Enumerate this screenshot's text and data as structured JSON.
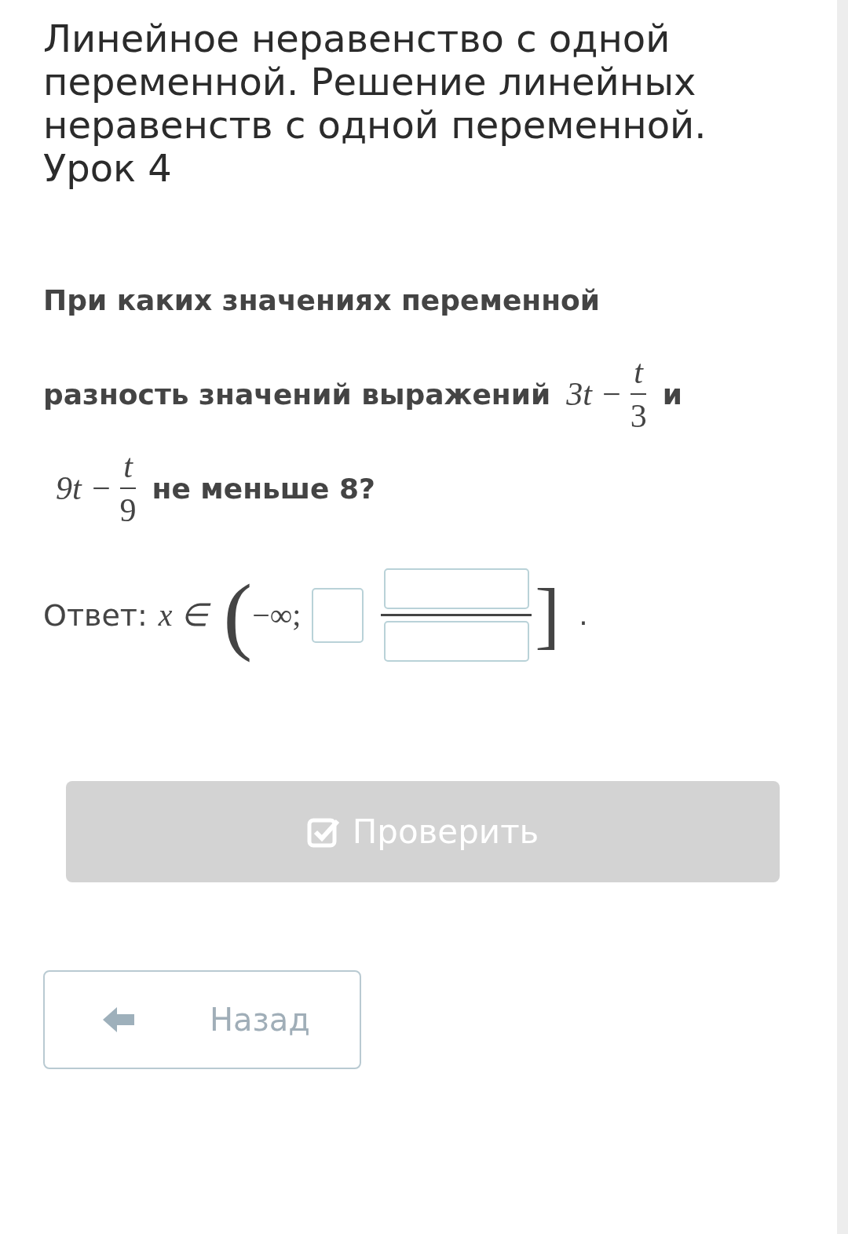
{
  "title": "Линейное неравенство с одной переменной. Решение линейных неравенств с одной переменной. Урок 4",
  "question": [
    {
      "parts": [
        {
          "kind": "text",
          "text": "При каких значениях переменной"
        }
      ]
    },
    {
      "parts": [
        {
          "kind": "text",
          "text": "разность значений выражений"
        },
        {
          "kind": "math",
          "lead": "3t −",
          "numerator": "t",
          "denominator": "3"
        },
        {
          "kind": "text",
          "text": "и"
        }
      ]
    },
    {
      "parts": [
        {
          "kind": "math",
          "lead": "9t −",
          "numerator": "t",
          "denominator": "9"
        },
        {
          "kind": "text",
          "text": "не меньше 8?"
        }
      ]
    }
  ],
  "answer": {
    "label": "Ответ:",
    "variable": "x ∈",
    "open": "(",
    "start": "−∞;",
    "close": "]",
    "end": "."
  },
  "check_button": {
    "label": "Проверить",
    "disabled": true
  },
  "back_button": {
    "label": "Назад"
  }
}
